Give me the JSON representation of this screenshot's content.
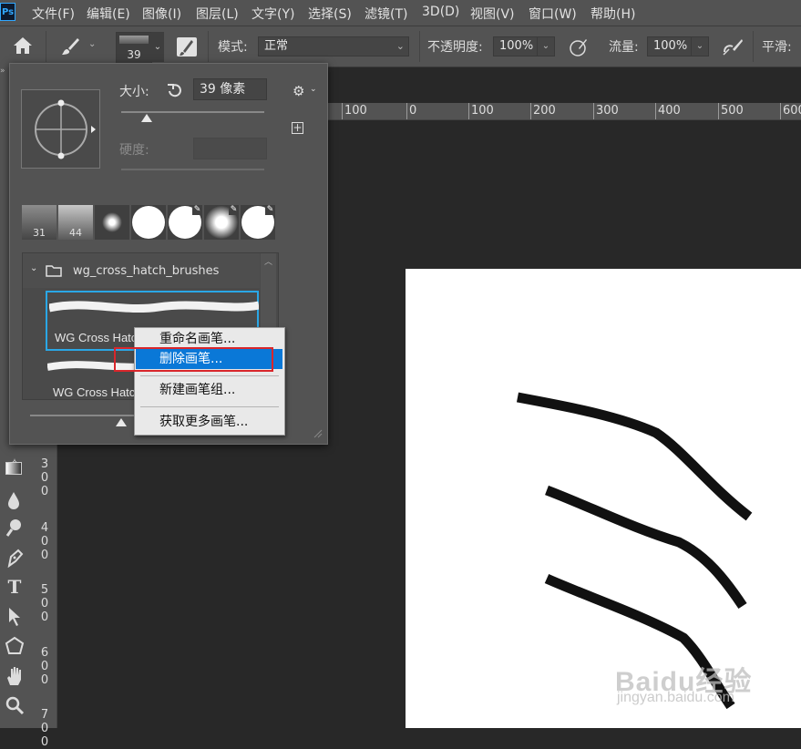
{
  "app": {
    "logo": "Ps"
  },
  "menubar": {
    "items": [
      "文件(F)",
      "编辑(E)",
      "图像(I)",
      "图层(L)",
      "文字(Y)",
      "选择(S)",
      "滤镜(T)",
      "3D(D)",
      "视图(V)",
      "窗口(W)",
      "帮助(H)"
    ]
  },
  "options": {
    "brush_size": "39",
    "mode_label": "模式:",
    "mode_value": "正常",
    "opacity_label": "不透明度:",
    "opacity_value": "100%",
    "flow_label": "流量:",
    "flow_value": "100%",
    "smooth_label": "平滑:"
  },
  "ruler": {
    "h_labels": [
      "100",
      "0",
      "100",
      "200",
      "300",
      "400",
      "500",
      "600"
    ],
    "v_labels": [
      "300",
      "400",
      "500",
      "600",
      "700"
    ]
  },
  "brush_panel": {
    "size_label": "大小:",
    "size_value": "39 像素",
    "hardness_label": "硬度:",
    "presets": [
      {
        "num": "31"
      },
      {
        "num": "44"
      }
    ],
    "folder_name": "wg_cross_hatch_brushes",
    "brush_names": [
      "WG Cross Hatch",
      "WG Cross Hatch"
    ]
  },
  "context_menu": {
    "items": [
      "重命名画笔...",
      "删除画笔...",
      "新建画笔组...",
      "获取更多画笔..."
    ],
    "highlighted_index": 1
  },
  "colors": {
    "highlight": "#0a78d7",
    "red_outline": "#d9262b",
    "selection_border": "#2aa7e6"
  },
  "watermark": {
    "line1": "Baidu经验",
    "line2": "jingyan.baidu.com"
  }
}
